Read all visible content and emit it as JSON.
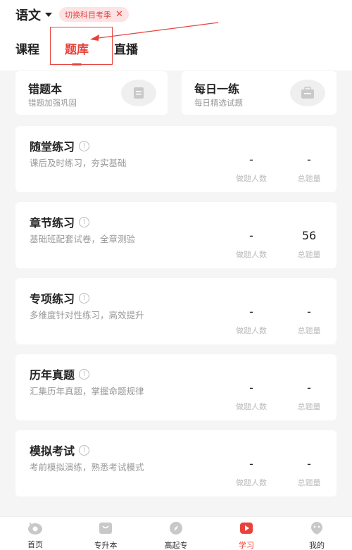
{
  "header": {
    "subject": "语文",
    "switch_label": "切换科目考季"
  },
  "tabs": [
    {
      "label": "课程",
      "active": false
    },
    {
      "label": "题库",
      "active": true
    },
    {
      "label": "直播",
      "active": false
    }
  ],
  "quick_cards": [
    {
      "title": "错题本",
      "subtitle": "错题加强巩固",
      "icon": "document-icon"
    },
    {
      "title": "每日一练",
      "subtitle": "每日精选试题",
      "icon": "briefcase-icon"
    }
  ],
  "practice_cards": [
    {
      "title": "随堂练习",
      "desc": "课后及时练习，夯实基础",
      "done": "-",
      "total": "-",
      "done_label": "做题人数",
      "total_label": "总题量"
    },
    {
      "title": "章节练习",
      "desc": "基础班配套试卷，全章测验",
      "done": "-",
      "total": "56",
      "done_label": "做题人数",
      "total_label": "总题量"
    },
    {
      "title": "专项练习",
      "desc": "多维度针对性练习，高效提升",
      "done": "-",
      "total": "-",
      "done_label": "做题人数",
      "total_label": "总题量"
    },
    {
      "title": "历年真题",
      "desc": "汇集历年真题，掌握命题规律",
      "done": "-",
      "total": "-",
      "done_label": "做题人数",
      "total_label": "总题量"
    },
    {
      "title": "模拟考试",
      "desc": "考前模拟演练，熟悉考试模式",
      "done": "-",
      "total": "-",
      "done_label": "做题人数",
      "total_label": "总题量"
    }
  ],
  "bottom_nav": [
    {
      "label": "首页",
      "icon": "home-icon",
      "active": false
    },
    {
      "label": "专升本",
      "icon": "bag-icon",
      "active": false
    },
    {
      "label": "高起专",
      "icon": "compass-icon",
      "active": false
    },
    {
      "label": "学习",
      "icon": "play-icon",
      "active": true
    },
    {
      "label": "我的",
      "icon": "profile-icon",
      "active": false
    }
  ],
  "colors": {
    "accent": "#e8423b",
    "chip_bg": "#fde3e3"
  }
}
